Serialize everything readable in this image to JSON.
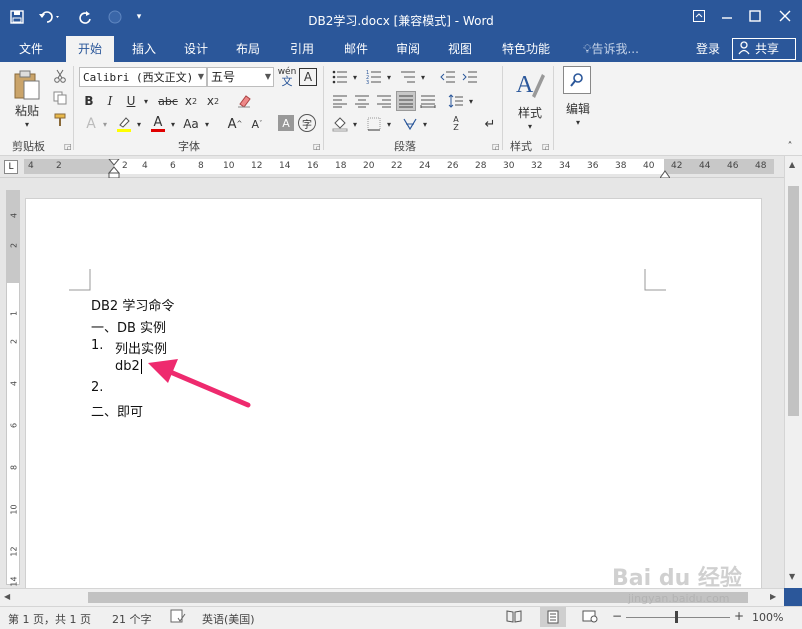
{
  "title_bar": {
    "doc_title": "DB2学习.docx [兼容模式] - Word"
  },
  "tabs": [
    {
      "label": "文件"
    },
    {
      "label": "开始"
    },
    {
      "label": "插入"
    },
    {
      "label": "设计"
    },
    {
      "label": "布局"
    },
    {
      "label": "引用"
    },
    {
      "label": "邮件"
    },
    {
      "label": "审阅"
    },
    {
      "label": "视图"
    },
    {
      "label": "特色功能"
    },
    {
      "label": "告诉我..."
    }
  ],
  "account": {
    "login": "登录",
    "share": "共享"
  },
  "ribbon": {
    "clipboard": {
      "paste": "粘贴",
      "label": "剪贴板"
    },
    "font": {
      "font_name": "Calibri (西文正文)",
      "font_size": "五号",
      "label": "字体"
    },
    "paragraph": {
      "label": "段落"
    },
    "styles": {
      "button": "样式",
      "label": "样式"
    },
    "editing": {
      "button": "编辑"
    }
  },
  "ruler": {
    "ticks": [
      "4",
      "2",
      "2",
      "4",
      "6",
      "8",
      "10",
      "12",
      "14",
      "16",
      "18",
      "20",
      "22",
      "24",
      "26",
      "28",
      "30",
      "32",
      "34",
      "36",
      "38",
      "40",
      "42",
      "44",
      "46",
      "48"
    ],
    "vticks": [
      "4",
      "2",
      "1",
      "2",
      "4",
      "6",
      "8",
      "10",
      "12",
      "14"
    ]
  },
  "document": {
    "lines": [
      "DB2 学习命令",
      "一、DB 实例",
      "1.",
      "列出实例",
      "db2",
      "2.",
      "二、即可"
    ]
  },
  "status": {
    "page": "第 1 页，共 1 页",
    "words": "21 个字",
    "language": "英语(美国)",
    "zoom": "100%"
  },
  "watermark": {
    "brand": "Bai du 经验",
    "url": "jingyan.baidu.com"
  }
}
